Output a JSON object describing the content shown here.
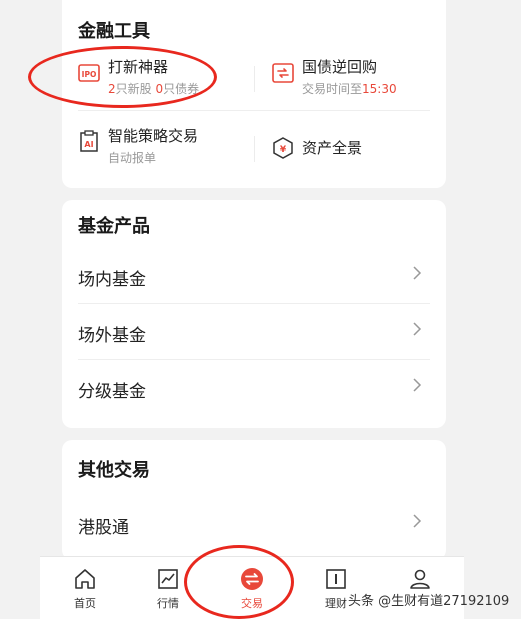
{
  "financial_tools": {
    "title": "金融工具",
    "items": [
      {
        "title": "打新神器",
        "icon": "ipo-icon",
        "sub_count_1": "2",
        "sub_text_1": "只新股 ",
        "sub_count_2": "0",
        "sub_text_2": "只债券"
      },
      {
        "title": "国债逆回购",
        "icon": "repo-icon",
        "sub_text": "交易时间至",
        "sub_time": "15:30"
      },
      {
        "title": "智能策略交易",
        "icon": "ai-icon",
        "sub_text": "自动报单"
      },
      {
        "title": "资产全景",
        "icon": "yuan-shield-icon"
      }
    ]
  },
  "fund_products": {
    "title": "基金产品",
    "items": [
      "场内基金",
      "场外基金",
      "分级基金"
    ]
  },
  "other_trading": {
    "title": "其他交易",
    "items": [
      "港股通"
    ]
  },
  "tabbar": {
    "items": [
      {
        "label": "首页",
        "icon": "home-icon"
      },
      {
        "label": "行情",
        "icon": "chart-icon"
      },
      {
        "label": "交易",
        "icon": "trade-icon",
        "active": true
      },
      {
        "label": "理财",
        "icon": "wealth-icon"
      },
      {
        "label": "我的",
        "icon": "user-icon"
      }
    ]
  },
  "watermark": "头条 @生财有道27192109",
  "colors": {
    "accent": "#e8483a",
    "annotation": "#e8281e"
  }
}
